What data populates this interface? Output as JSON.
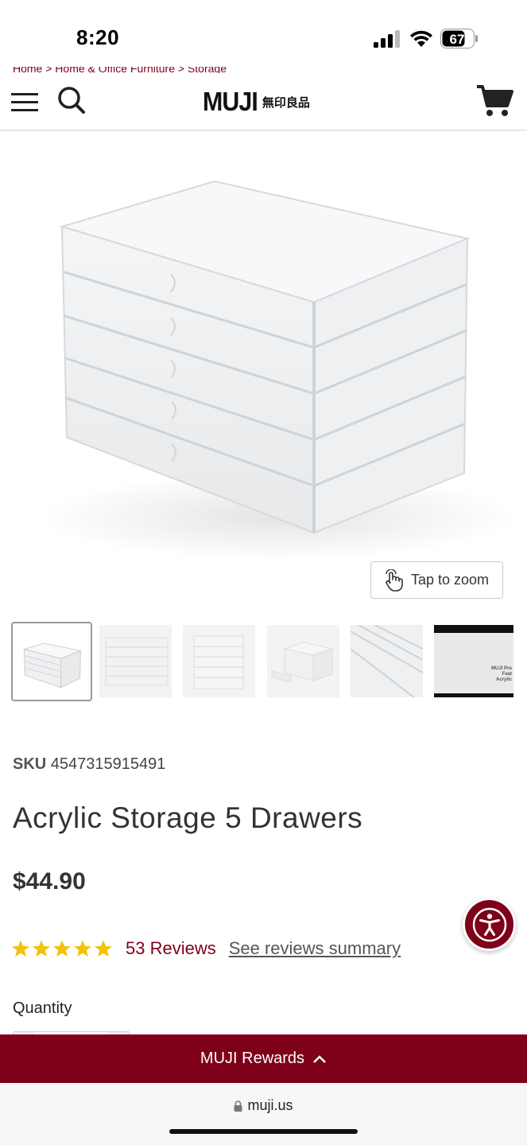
{
  "status_bar": {
    "time": "8:20",
    "battery": "67",
    "icons": [
      "signal-icon",
      "wifi-icon",
      "battery-icon"
    ]
  },
  "breadcrumb": "Home  >  Home & Office Furniture  >  Storage",
  "header": {
    "logo_text": "MUJI",
    "logo_subtext": "無印良品",
    "icons": [
      "menu-icon",
      "search-icon",
      "cart-icon"
    ]
  },
  "gallery": {
    "zoom_label": "Tap to zoom",
    "video_thumb_text": "MUJI Pro\nFeat\nAcrylic"
  },
  "product": {
    "sku_label": "SKU",
    "sku_value": "4547315915491",
    "title": "Acrylic Storage 5 Drawers",
    "price": "$44.90",
    "rating": 5,
    "reviews": "53 Reviews",
    "summary_link": "See reviews summary",
    "quantity_label": "Quantity"
  },
  "rewards_bar": {
    "label": "MUJI Rewards"
  },
  "browser": {
    "url": "muji.us"
  },
  "colors": {
    "brand": "#7f0019",
    "star": "#f4c20d"
  }
}
